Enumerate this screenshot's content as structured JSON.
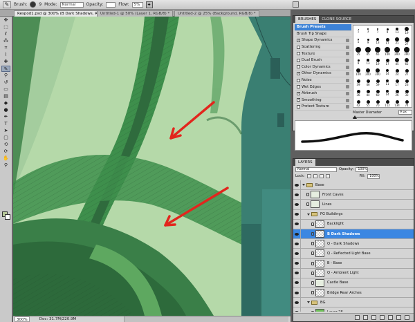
{
  "options_bar": {
    "brush_label": "Brush:",
    "brush_size": "9",
    "mode_label": "Mode:",
    "mode_value": "Normal",
    "opacity_label": "Opacity:",
    "flow_label": "Flow:",
    "flow_value": "5%"
  },
  "tabs": [
    {
      "label": "Respod1.psd @ 300% (B Dark Shadows, RGB/8) *",
      "active": true
    },
    {
      "label": "Untitled-1 @ 50% (Layer 1, RGB/8) *",
      "active": false
    },
    {
      "label": "Untitled-2 @ 25% (Background, RGB/8) *",
      "active": false
    }
  ],
  "tools": [
    "move",
    "marquee",
    "lasso",
    "quick-select",
    "crop",
    "eyedropper",
    "healing",
    "brush",
    "clone",
    "history-brush",
    "eraser",
    "gradient",
    "blur",
    "dodge",
    "pen",
    "type",
    "path-select",
    "shape",
    "3d-rotate",
    "3d-camera",
    "hand",
    "zoom"
  ],
  "canvas": {
    "arrow_color": "#e2261d",
    "colors": {
      "sky": "#b5d9a9",
      "vine_dark": "#2f6b3d",
      "vine_mid": "#3e8f4c",
      "vine_light": "#5ea860",
      "tower": "#3a7f72"
    }
  },
  "status": {
    "zoom": "300%",
    "doc": "Doc: 31.7M/220.9M"
  },
  "brushes_panel": {
    "tabs": [
      "BRUSHES",
      "CLONE SOURCE"
    ],
    "items": [
      {
        "label": "Brush Presets",
        "checkbox": false,
        "highlight": true,
        "lock": false
      },
      {
        "label": "Brush Tip Shape",
        "checkbox": false,
        "highlight": false,
        "lock": false
      },
      {
        "label": "Shape Dynamics",
        "checkbox": true,
        "checked": true,
        "lock": true
      },
      {
        "label": "Scattering",
        "checkbox": true,
        "checked": false,
        "lock": true
      },
      {
        "label": "Texture",
        "checkbox": true,
        "checked": false,
        "lock": true
      },
      {
        "label": "Dual Brush",
        "checkbox": true,
        "checked": false,
        "lock": true
      },
      {
        "label": "Color Dynamics",
        "checkbox": true,
        "checked": false,
        "lock": true
      },
      {
        "label": "Other Dynamics",
        "checkbox": true,
        "checked": true,
        "lock": true
      },
      {
        "label": "Noise",
        "checkbox": true,
        "checked": false,
        "lock": true
      },
      {
        "label": "Wet Edges",
        "checkbox": true,
        "checked": false,
        "lock": true
      },
      {
        "label": "Airbrush",
        "checkbox": true,
        "checked": true,
        "lock": true
      },
      {
        "label": "Smoothing",
        "checkbox": true,
        "checked": true,
        "lock": true
      },
      {
        "label": "Protect Texture",
        "checkbox": true,
        "checked": false,
        "lock": true
      }
    ],
    "presets": [
      {
        "n": "1",
        "s": 1
      },
      {
        "n": "3",
        "s": 2
      },
      {
        "n": "5",
        "s": 2
      },
      {
        "n": "9",
        "s": 3
      },
      {
        "n": "13",
        "s": 4
      },
      {
        "n": "19",
        "s": 6
      },
      {
        "n": "5",
        "s": 2
      },
      {
        "n": "9",
        "s": 3
      },
      {
        "n": "13",
        "s": 4
      },
      {
        "n": "17",
        "s": 5
      },
      {
        "n": "21",
        "s": 6
      },
      {
        "n": "27",
        "s": 7
      },
      {
        "n": "35",
        "s": 8
      },
      {
        "n": "45",
        "s": 8
      },
      {
        "n": "65",
        "s": 8
      },
      {
        "n": "100",
        "s": 8
      },
      {
        "n": "200",
        "s": 8
      },
      {
        "n": "300",
        "s": 8
      },
      {
        "n": "9",
        "s": 3
      },
      {
        "n": "13",
        "s": 4
      },
      {
        "n": "19",
        "s": 5
      },
      {
        "n": "17",
        "s": 5
      },
      {
        "n": "45",
        "s": 6
      },
      {
        "n": "65",
        "s": 6
      },
      {
        "n": "100",
        "s": 6
      },
      {
        "n": "200",
        "s": 6
      },
      {
        "n": "300",
        "s": 6
      },
      {
        "n": "14",
        "s": 4
      },
      {
        "n": "24",
        "s": 5
      },
      {
        "n": "27",
        "s": 5
      },
      {
        "n": "39",
        "s": 5
      },
      {
        "n": "46",
        "s": 5
      },
      {
        "n": "59",
        "s": 5
      },
      {
        "n": "11",
        "s": 4
      },
      {
        "n": "17",
        "s": 5
      },
      {
        "n": "23",
        "s": 5
      },
      {
        "n": "36",
        "s": 5
      },
      {
        "n": "44",
        "s": 5
      },
      {
        "n": "60",
        "s": 5
      },
      {
        "n": "14",
        "s": 4
      },
      {
        "n": "26",
        "s": 5
      },
      {
        "n": "33",
        "s": 5
      },
      {
        "n": "42",
        "s": 5
      },
      {
        "n": "55",
        "s": 5
      },
      {
        "n": "70",
        "s": 5
      },
      {
        "n": "112",
        "s": 5
      },
      {
        "n": "134",
        "s": 5
      },
      {
        "n": "74",
        "s": 5
      }
    ],
    "master_diameter_label": "Master Diameter",
    "master_diameter_value": "9 px",
    "master_diameter_fraction": 0.03
  },
  "layers_panel": {
    "tab": "LAYERS",
    "blend_mode": "Normal",
    "opacity_label": "Opacity:",
    "opacity_value": "100%",
    "lock_label": "Lock:",
    "fill_label": "Fill:",
    "fill_value": "100%",
    "rows": [
      {
        "name": "Base",
        "type": "group",
        "indent": 0,
        "selected": false
      },
      {
        "name": "Front Caves",
        "type": "art",
        "indent": 1,
        "selected": false
      },
      {
        "name": "Lines",
        "type": "art",
        "indent": 1,
        "selected": false
      },
      {
        "name": "FG Buildings",
        "type": "group",
        "indent": 1,
        "selected": false
      },
      {
        "name": "Backlight",
        "type": "layer",
        "indent": 2,
        "selected": false
      },
      {
        "name": "B Dark Shadows",
        "type": "layer",
        "indent": 2,
        "selected": true
      },
      {
        "name": "Q - Dark Shadows",
        "type": "layer",
        "indent": 2,
        "selected": false
      },
      {
        "name": "Q - Reflected Light Base",
        "type": "layer",
        "indent": 2,
        "selected": false
      },
      {
        "name": "B - Base",
        "type": "layer",
        "indent": 2,
        "selected": false
      },
      {
        "name": "Q - Ambient Light",
        "type": "layer",
        "indent": 2,
        "selected": false
      },
      {
        "name": "Castle Base",
        "type": "art",
        "indent": 2,
        "selected": false
      },
      {
        "name": "Bridge Rear Arches",
        "type": "layer",
        "indent": 2,
        "selected": false
      },
      {
        "name": "BG",
        "type": "group",
        "indent": 1,
        "selected": false
      },
      {
        "name": "Layer 28",
        "type": "green",
        "indent": 2,
        "selected": false
      }
    ]
  }
}
